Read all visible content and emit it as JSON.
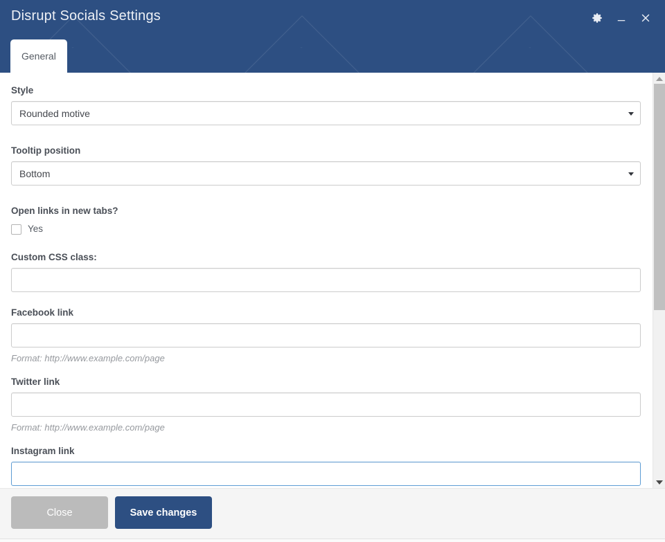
{
  "window": {
    "title": "Disrupt Socials Settings",
    "accent_color": "#2d4f82",
    "controls": [
      {
        "name": "settings-gear",
        "icon": "gear-icon"
      },
      {
        "name": "minimize",
        "icon": "minimize-icon"
      },
      {
        "name": "close",
        "icon": "close-icon"
      }
    ]
  },
  "tabs": [
    {
      "label": "General",
      "active": true
    }
  ],
  "form": {
    "style": {
      "label": "Style",
      "value": "Rounded motive",
      "options": [
        "Rounded motive"
      ]
    },
    "tooltip_position": {
      "label": "Tooltip position",
      "value": "Bottom",
      "options": [
        "Bottom"
      ]
    },
    "open_links_new_tabs": {
      "label": "Open links in new tabs?",
      "checkbox_label": "Yes",
      "checked": false
    },
    "custom_css_class": {
      "label": "Custom CSS class:",
      "value": "",
      "placeholder": ""
    },
    "facebook_link": {
      "label": "Facebook link",
      "value": "",
      "placeholder": "",
      "hint": "Format: http://www.example.com/page"
    },
    "twitter_link": {
      "label": "Twitter link",
      "value": "",
      "placeholder": "",
      "hint": "Format: http://www.example.com/page"
    },
    "instagram_link": {
      "label": "Instagram link",
      "value": "",
      "placeholder": "",
      "focused": true,
      "focus_color": "#5d9cd4"
    }
  },
  "footer": {
    "close_label": "Close",
    "save_label": "Save changes"
  }
}
